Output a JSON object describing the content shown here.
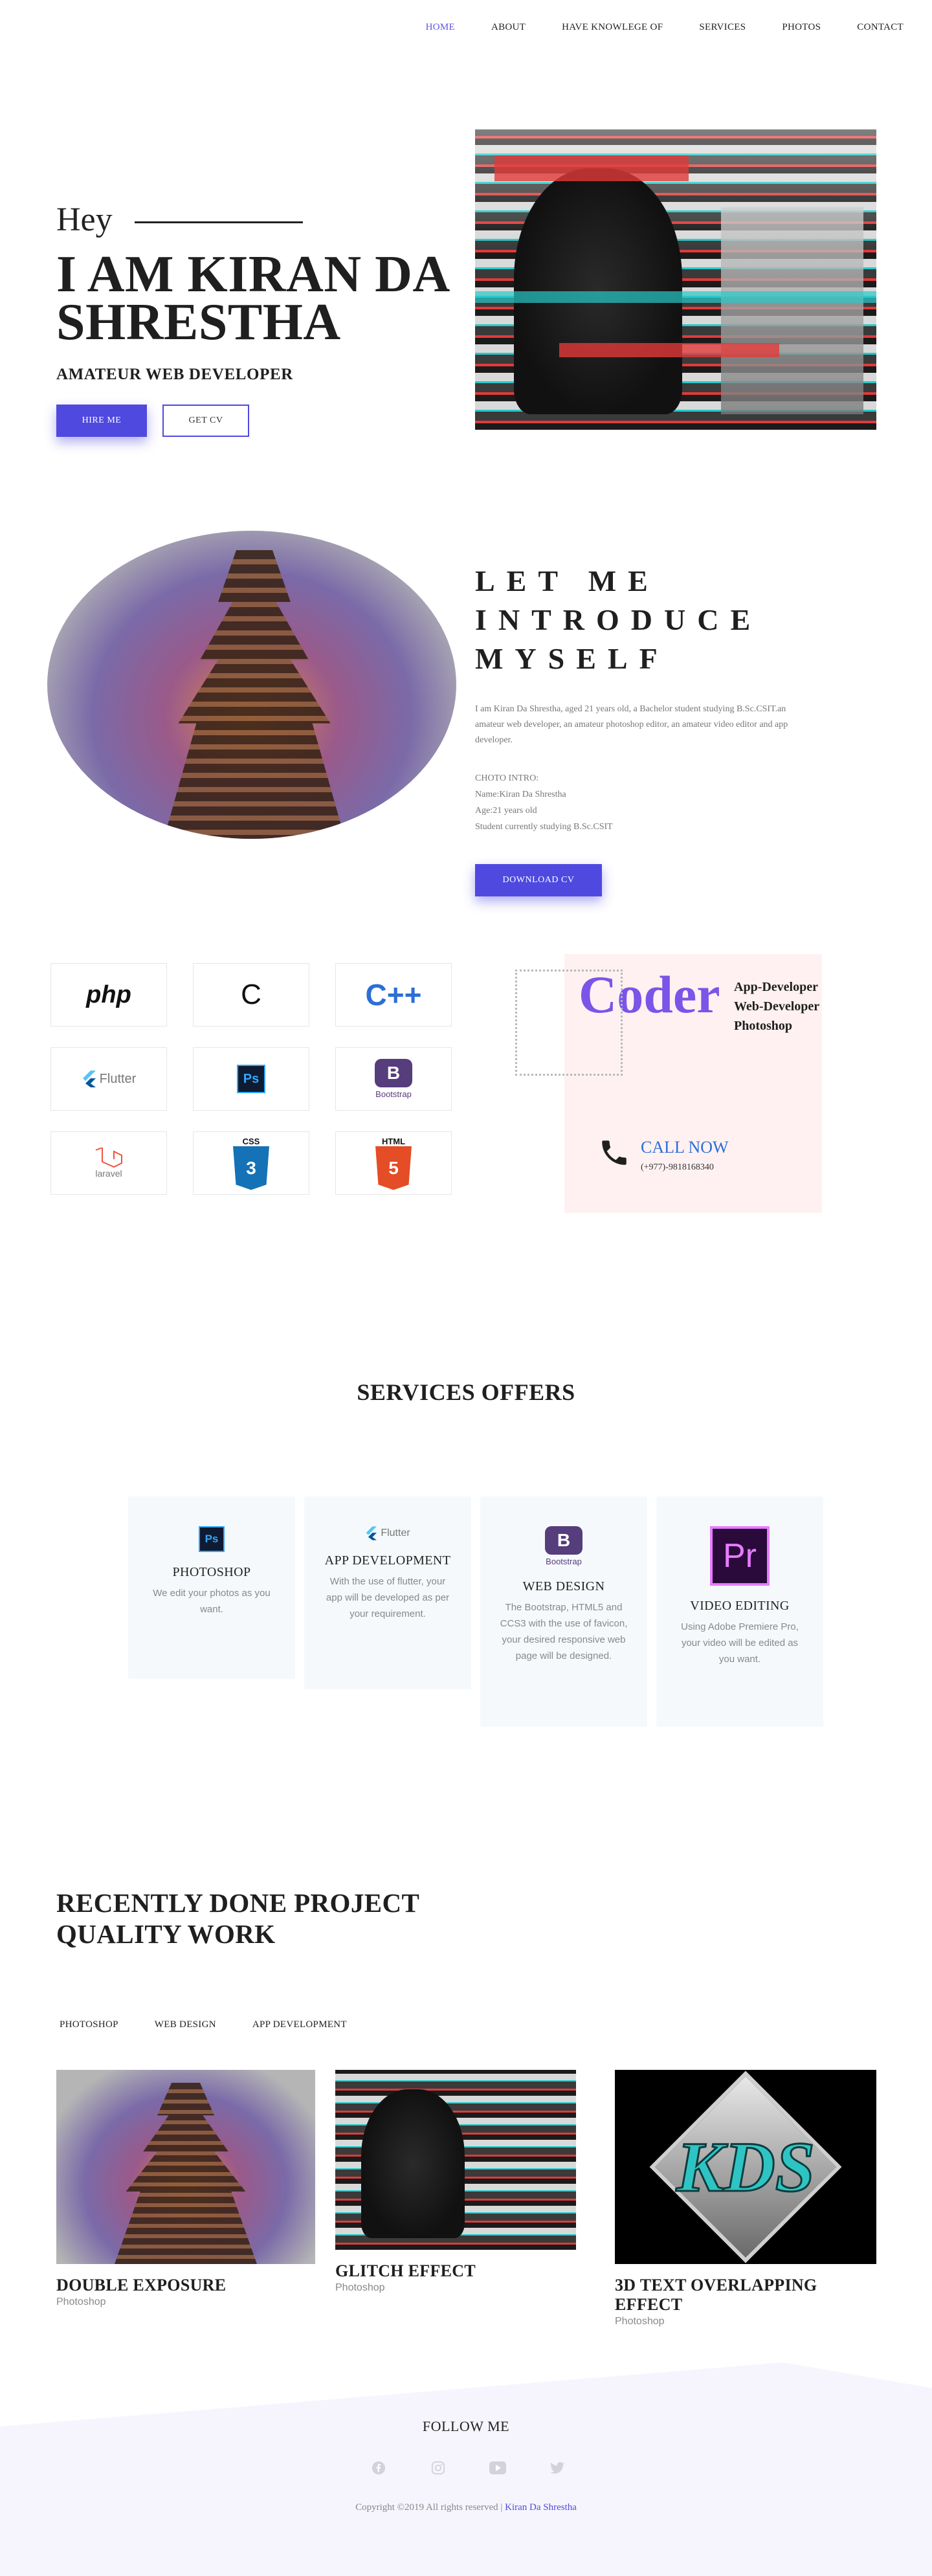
{
  "nav": {
    "items": [
      "HOME",
      "ABOUT",
      "HAVE KNOWLEGE OF",
      "SERVICES",
      "PHOTOS",
      "CONTACT"
    ],
    "active": "HOME",
    "active_color": "#5b54e8"
  },
  "hero": {
    "greeting": "Hey",
    "name": "I AM KIRAN DA SHRESTHA",
    "role": "AMATEUR WEB DEVELOPER",
    "hire_label": "HIRE ME",
    "cv_label": "GET CV"
  },
  "intro": {
    "title": "LET ME INTRODUCE MYSELF",
    "text": "I am Kiran Da Shrestha, aged 21 years old, a Bachelor student studying B.Sc.CSIT.an amateur web developer, an amateur photoshop editor, an amateur video editor and app developer.",
    "info_heading": "CHOTO INTRO:",
    "info_name": "Name:Kiran Da Shrestha",
    "info_age": "Age:21 years old",
    "info_study": "Student currently studying B.Sc.CSIT",
    "download_label": "DOWNLOAD CV"
  },
  "skills": {
    "php": "php",
    "c": "C",
    "cpp": "C++",
    "flutter": "Flutter",
    "ps": "Ps",
    "bootstrap": "B",
    "bootstrap_label": "Bootstrap",
    "laravel": "laravel",
    "css_top": "CSS",
    "css": "3",
    "html_top": "HTML",
    "html": "5"
  },
  "coder": {
    "word": "Coder",
    "roles": [
      "App-Developer",
      "Web-Developer",
      "Photoshop"
    ],
    "call_label": "CALL NOW",
    "phone": "(+977)-9818168340"
  },
  "services": {
    "title": "SERVICES OFFERS",
    "items": [
      {
        "name": "PHOTOSHOP",
        "desc": "We edit your photos as you want.",
        "icon": "Ps"
      },
      {
        "name": "APP DEVELOPMENT",
        "desc": "With the use of flutter, your app will be developed as per your requirement.",
        "icon": "Flutter"
      },
      {
        "name": "WEB DESIGN",
        "desc": "The Bootstrap, HTML5 and CCS3 with the use of favicon, your desired responsive web page will be designed.",
        "icon": "B",
        "icon_label": "Bootstrap"
      },
      {
        "name": "VIDEO EDITING",
        "desc": "Using Adobe Premiere Pro, your video will be edited as you want.",
        "icon": "Pr"
      }
    ]
  },
  "projects": {
    "title_line1": "RECENTLY DONE PROJECT",
    "title_line2": "QUALITY WORK",
    "tabs": [
      "PHOTOSHOP",
      "WEB DESIGN",
      "APP DEVELOPMENT"
    ],
    "items": [
      {
        "name": "DOUBLE EXPOSURE",
        "category": "Photoshop"
      },
      {
        "name": "GLITCH EFFECT",
        "category": "Photoshop"
      },
      {
        "name": "3D TEXT OVERLAPPING EFFECT",
        "category": "Photoshop",
        "logo_text": "KDS"
      }
    ]
  },
  "footer": {
    "follow": "FOLLOW ME",
    "copyright": "Copyright ©2019 All rights reserved |",
    "author": "Kiran Da Shrestha",
    "social_icons": [
      "facebook-icon",
      "instagram-icon",
      "youtube-icon",
      "twitter-icon"
    ]
  },
  "colors": {
    "accent": "#4f49e0",
    "coder_purple": "#7b54e8",
    "call_blue": "#2c6ed6"
  }
}
